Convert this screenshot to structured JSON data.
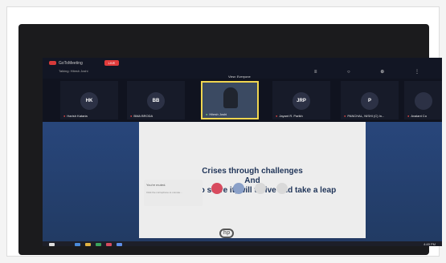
{
  "titlebar": {
    "app_name": "GoToMeeting",
    "badge": "LIVE",
    "talking": "Talking: Hitesh Joshi",
    "view": "View: Everyone",
    "controls": "≡ ○ ⊕ ⋮"
  },
  "participants": [
    {
      "initials": "HK",
      "name": "Harish Kataria"
    },
    {
      "initials": "BB",
      "name": "BMA BRODA"
    },
    {
      "initials": "",
      "name": "Hitesh Joshi"
    },
    {
      "initials": "JRP",
      "name": "Jayant R. Parikh"
    },
    {
      "initials": "P",
      "name": "PANCHAL, NISHI (C) In..."
    },
    {
      "initials": "",
      "name": "Avalant Co"
    }
  ],
  "slide": {
    "line1": "Crises through challenges",
    "line2": "And",
    "line3": "Only who solve it, will thrive and take a leap"
  },
  "popup": {
    "title": "You're muted.",
    "text": "Click the microphone to unmute..."
  },
  "taskbar": {
    "time": "4:49 PM"
  },
  "brand": "hp",
  "colors": {
    "accent": "#d84b5f",
    "slide_text": "#1f3458",
    "background_blue": "#243a63"
  }
}
